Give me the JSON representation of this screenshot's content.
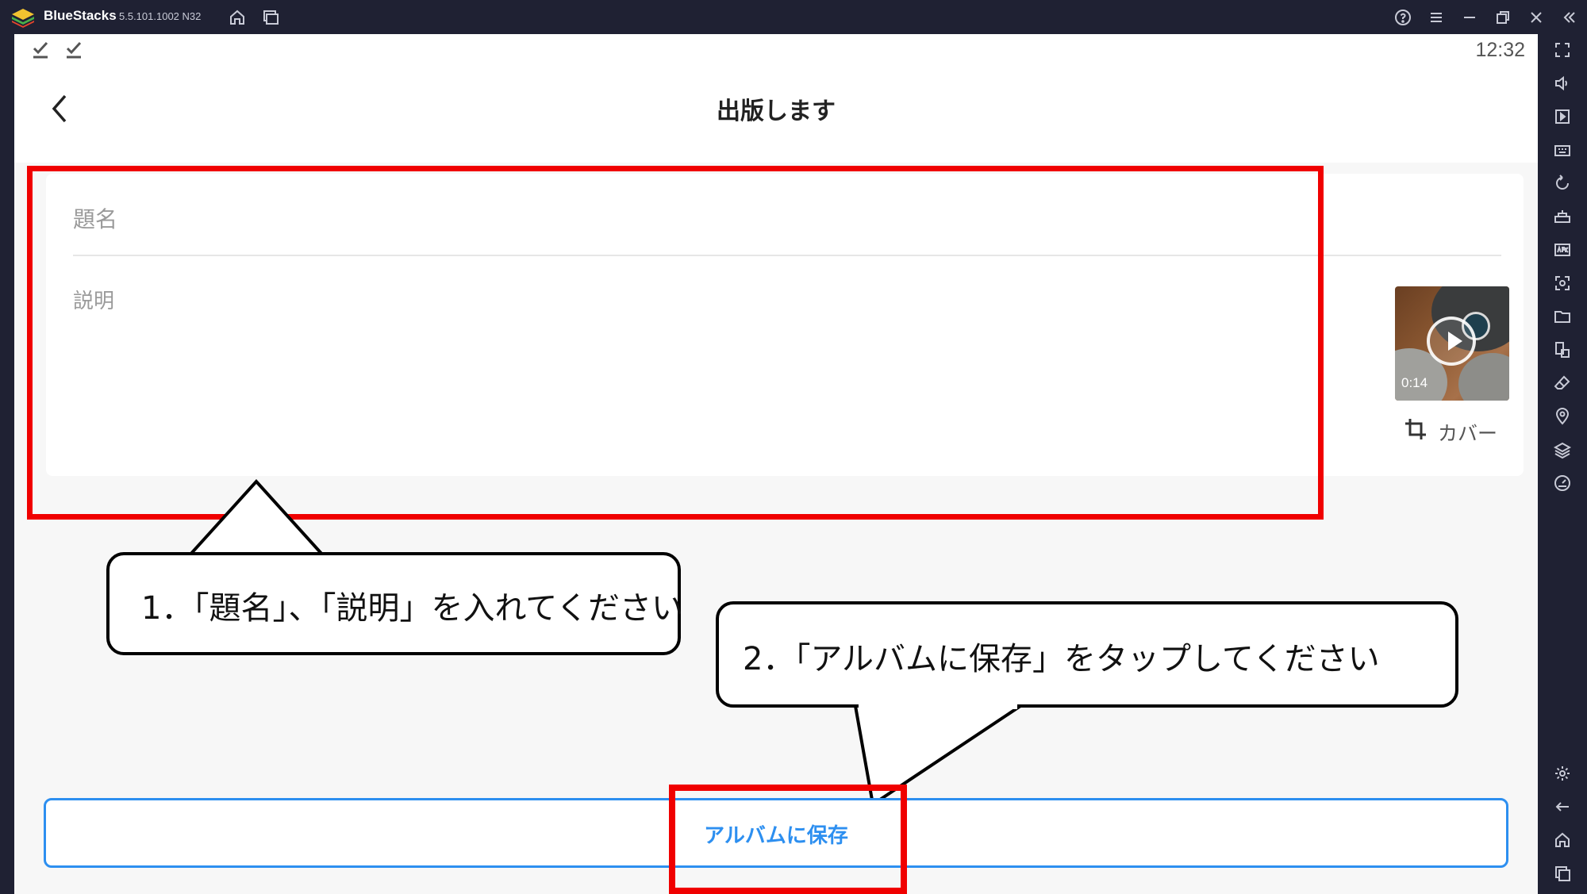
{
  "window": {
    "app_name": "BlueStacks",
    "version": "5.5.101.1002  N32"
  },
  "status_bar": {
    "time": "12:32"
  },
  "header": {
    "title": "出版します"
  },
  "form": {
    "title_placeholder": "題名",
    "description_placeholder": "説明",
    "video_duration": "0:14",
    "cover_label": "カバー"
  },
  "annotations": {
    "callout_1": "1．「題名」、「説明」を入れてください",
    "callout_2": "2．「アルバムに保存」をタップしてください",
    "highlight_color": "#f00000"
  },
  "save_button": {
    "label": "アルバムに保存",
    "color": "#2d8ff0"
  },
  "icons": {
    "titlebar": [
      "home-icon",
      "multi-instance-icon",
      "help-icon",
      "menu-icon",
      "minimize-icon",
      "restore-icon",
      "close-icon",
      "collapse-sidebar-icon"
    ],
    "sidebar": [
      "fullscreen-icon",
      "volume-icon",
      "media-icon",
      "keyboard-icon",
      "rotate-icon",
      "macro-icon",
      "apk-icon",
      "screenshot-icon",
      "folder-icon",
      "multi-window-icon",
      "eraser-icon",
      "location-icon",
      "layers-icon",
      "speed-icon",
      "settings-icon",
      "back-icon",
      "home-icon",
      "recents-icon"
    ]
  }
}
